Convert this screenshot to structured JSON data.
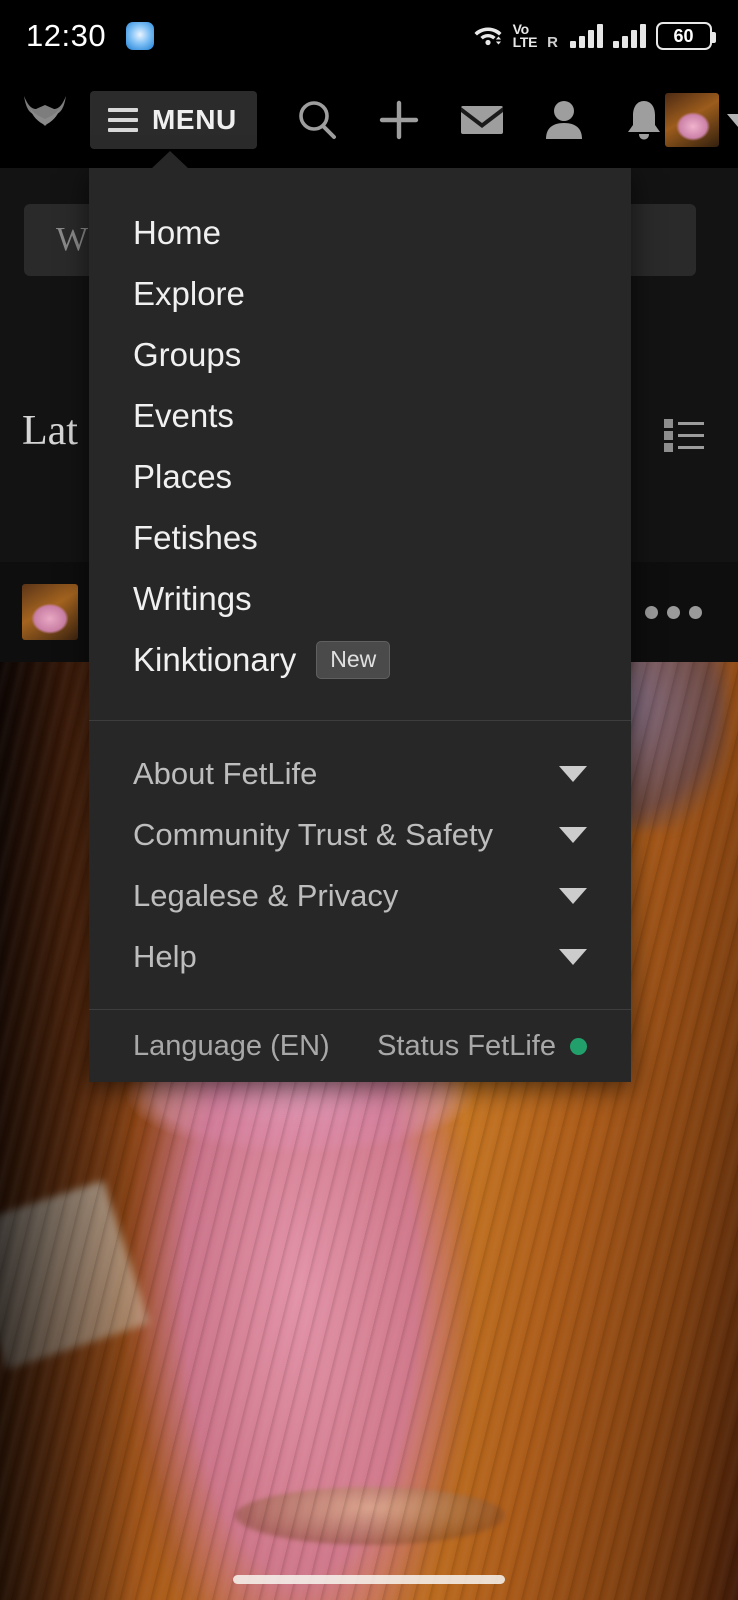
{
  "status_bar": {
    "time": "12:30",
    "app_icon": "message-app-icon",
    "wifi_icon": "wifi-icon",
    "volte_line1": "Vo",
    "volte_line2": "LTE",
    "roaming_label": "R",
    "signal1_icon": "signal-bars-icon",
    "signal2_icon": "signal-bars-icon",
    "battery_level": "60"
  },
  "nav_bar": {
    "logo_icon": "fetlife-logo-icon",
    "menu_label": "MENU",
    "menu_icon": "hamburger-icon",
    "icons": [
      {
        "name": "search-icon",
        "label": "Search"
      },
      {
        "name": "plus-icon",
        "label": "Create"
      },
      {
        "name": "mail-icon",
        "label": "Messages"
      },
      {
        "name": "person-icon",
        "label": "Friends"
      },
      {
        "name": "bell-icon",
        "label": "Notifications"
      }
    ],
    "avatar_icon": "user-avatar",
    "caret_icon": "chevron-down-icon"
  },
  "background_app": {
    "compose_placeholder": "W",
    "section_heading": "Lat",
    "list_view_icon": "list-view-icon",
    "feed_avatar": "feed-avatar",
    "more_options_icon": "more-options-icon"
  },
  "menu": {
    "primary_items": [
      {
        "label": "Home",
        "badge": ""
      },
      {
        "label": "Explore",
        "badge": ""
      },
      {
        "label": "Groups",
        "badge": ""
      },
      {
        "label": "Events",
        "badge": ""
      },
      {
        "label": "Places",
        "badge": ""
      },
      {
        "label": "Fetishes",
        "badge": ""
      },
      {
        "label": "Writings",
        "badge": ""
      },
      {
        "label": "Kinktionary",
        "badge": "New"
      }
    ],
    "secondary_items": [
      {
        "label": "About FetLife"
      },
      {
        "label": "Community Trust & Safety"
      },
      {
        "label": "Legalese & Privacy"
      },
      {
        "label": "Help"
      }
    ],
    "footer": {
      "language": "Language (EN)",
      "status_label": "Status FetLife",
      "status_color": "#22a06b"
    }
  },
  "colors": {
    "menu_background": "#272727",
    "nav_background": "#000000",
    "menu_button_background": "#2b2b2b",
    "badge_background": "#4a4a4a",
    "status_green": "#22a06b"
  }
}
